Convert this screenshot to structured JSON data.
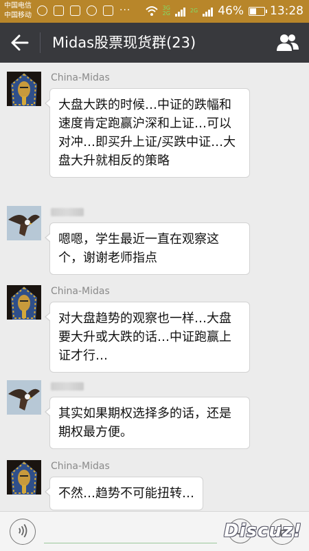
{
  "status_bar": {
    "carrier_1": "中国电信",
    "carrier_2": "中国移动",
    "dots": "···",
    "net_3g": "3G",
    "net_2g_a": "2G",
    "net_2g_b": "2G",
    "battery": "46%",
    "battery_level": 0.46,
    "time": "13:28"
  },
  "title_bar": {
    "title": "Midas股票现货群(23)",
    "back_icon": "arrow-left-icon",
    "members_icon": "group-members-icon"
  },
  "messages": [
    {
      "sender": "China-Midas",
      "avatar": "pharaoh-avatar",
      "text": "大盘大跌的时候…中证的跌幅和速度肯定跑赢沪深和上证…可以对冲…即买升上证/买跌中证…大盘大升就相反的策略"
    },
    {
      "sender": "",
      "avatar": "eagle-avatar",
      "text": "嗯嗯，学生最近一直在观察这个，谢谢老师指点"
    },
    {
      "sender": "China-Midas",
      "avatar": "pharaoh-avatar",
      "text": "对大盘趋势的观察也一样…大盘要大升或大跌的话…中证跑赢上证才行…"
    },
    {
      "sender": "",
      "avatar": "eagle-avatar",
      "text": "其实如果期权选择多的话，还是期权最方便。"
    },
    {
      "sender": "China-Midas",
      "avatar": "pharaoh-avatar",
      "text": "不然…趋势不可能扭转…"
    }
  ],
  "input_bar": {
    "voice_icon": "voice-wave-icon",
    "emoji_icon": "smiley-icon",
    "plus_icon": "plus-icon"
  },
  "watermark": "Discuz!",
  "colors": {
    "status_bar": "#b8862a",
    "title_bar": "#38393d",
    "chat_bg": "#ececec",
    "bubble": "#ffffff"
  }
}
